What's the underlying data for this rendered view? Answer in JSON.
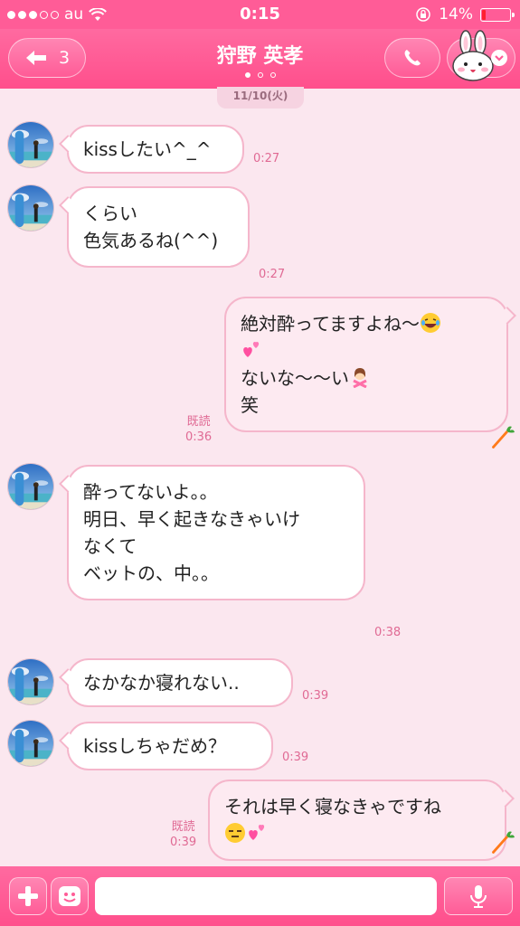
{
  "status_bar": {
    "carrier": "au",
    "time": "0:15",
    "battery_percent": "14%",
    "battery_level": 0.14
  },
  "nav": {
    "back_count": "3",
    "title": "狩野 英孝",
    "page_index": 0,
    "page_count": 3
  },
  "date_label": "11/10(火)",
  "messages": [
    {
      "side": "in",
      "lines": [
        "kissしたい^_^"
      ],
      "time": "0:27"
    },
    {
      "side": "in",
      "lines": [
        "くらい",
        "",
        "色気あるね(^^)"
      ],
      "time": "0:27"
    },
    {
      "side": "out",
      "lines": [
        "絶対酔ってますよね〜",
        "",
        "",
        "ないな〜〜い",
        "笑"
      ],
      "time": "0:36",
      "read": "既読"
    },
    {
      "side": "in",
      "lines": [
        "酔ってないよ。。",
        "",
        "明日、早く起きなきゃいけ",
        "なくて",
        "",
        "ベットの、中。。"
      ],
      "time": "0:38"
    },
    {
      "side": "in",
      "lines": [
        "なかなか寝れない.."
      ],
      "time": "0:39"
    },
    {
      "side": "in",
      "lines": [
        "kissしちゃだめ？"
      ],
      "time": "0:39"
    },
    {
      "side": "out",
      "lines": [
        "それは早く寝なきゃですね",
        ""
      ],
      "time": "0:39",
      "read": "既読"
    }
  ],
  "icons": {
    "back": "back-arrow-icon",
    "call": "phone-icon",
    "menu": "bunny-sticker-icon",
    "add": "plus-icon",
    "sticker": "smiley-icon",
    "voice": "microphone-icon"
  },
  "colors": {
    "header": "#ff5c97",
    "background": "#fbe7ef",
    "bubble_border": "#f5b6cb",
    "timestamp": "#e06a94"
  },
  "input": {
    "placeholder": ""
  }
}
